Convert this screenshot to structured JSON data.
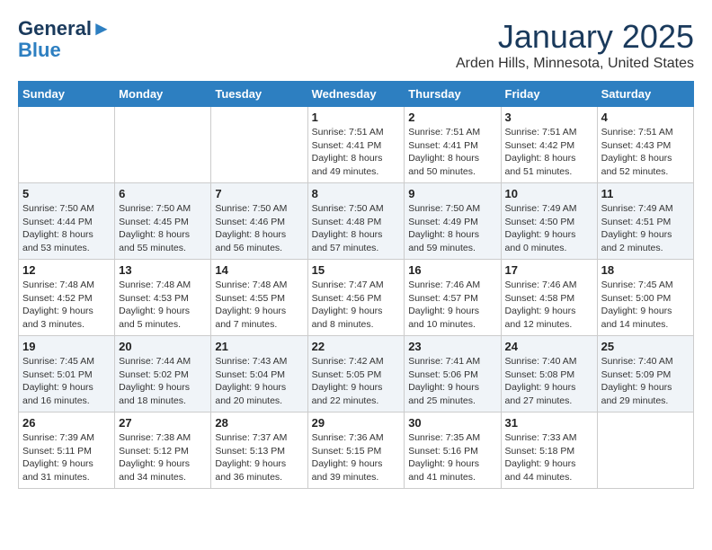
{
  "logo": {
    "line1": "General",
    "line2": "Blue"
  },
  "title": "January 2025",
  "location": "Arden Hills, Minnesota, United States",
  "days_header": [
    "Sunday",
    "Monday",
    "Tuesday",
    "Wednesday",
    "Thursday",
    "Friday",
    "Saturday"
  ],
  "weeks": [
    [
      {
        "day": "",
        "sunrise": "",
        "sunset": "",
        "daylight": ""
      },
      {
        "day": "",
        "sunrise": "",
        "sunset": "",
        "daylight": ""
      },
      {
        "day": "",
        "sunrise": "",
        "sunset": "",
        "daylight": ""
      },
      {
        "day": "1",
        "sunrise": "Sunrise: 7:51 AM",
        "sunset": "Sunset: 4:41 PM",
        "daylight": "Daylight: 8 hours and 49 minutes."
      },
      {
        "day": "2",
        "sunrise": "Sunrise: 7:51 AM",
        "sunset": "Sunset: 4:41 PM",
        "daylight": "Daylight: 8 hours and 50 minutes."
      },
      {
        "day": "3",
        "sunrise": "Sunrise: 7:51 AM",
        "sunset": "Sunset: 4:42 PM",
        "daylight": "Daylight: 8 hours and 51 minutes."
      },
      {
        "day": "4",
        "sunrise": "Sunrise: 7:51 AM",
        "sunset": "Sunset: 4:43 PM",
        "daylight": "Daylight: 8 hours and 52 minutes."
      }
    ],
    [
      {
        "day": "5",
        "sunrise": "Sunrise: 7:50 AM",
        "sunset": "Sunset: 4:44 PM",
        "daylight": "Daylight: 8 hours and 53 minutes."
      },
      {
        "day": "6",
        "sunrise": "Sunrise: 7:50 AM",
        "sunset": "Sunset: 4:45 PM",
        "daylight": "Daylight: 8 hours and 55 minutes."
      },
      {
        "day": "7",
        "sunrise": "Sunrise: 7:50 AM",
        "sunset": "Sunset: 4:46 PM",
        "daylight": "Daylight: 8 hours and 56 minutes."
      },
      {
        "day": "8",
        "sunrise": "Sunrise: 7:50 AM",
        "sunset": "Sunset: 4:48 PM",
        "daylight": "Daylight: 8 hours and 57 minutes."
      },
      {
        "day": "9",
        "sunrise": "Sunrise: 7:50 AM",
        "sunset": "Sunset: 4:49 PM",
        "daylight": "Daylight: 8 hours and 59 minutes."
      },
      {
        "day": "10",
        "sunrise": "Sunrise: 7:49 AM",
        "sunset": "Sunset: 4:50 PM",
        "daylight": "Daylight: 9 hours and 0 minutes."
      },
      {
        "day": "11",
        "sunrise": "Sunrise: 7:49 AM",
        "sunset": "Sunset: 4:51 PM",
        "daylight": "Daylight: 9 hours and 2 minutes."
      }
    ],
    [
      {
        "day": "12",
        "sunrise": "Sunrise: 7:48 AM",
        "sunset": "Sunset: 4:52 PM",
        "daylight": "Daylight: 9 hours and 3 minutes."
      },
      {
        "day": "13",
        "sunrise": "Sunrise: 7:48 AM",
        "sunset": "Sunset: 4:53 PM",
        "daylight": "Daylight: 9 hours and 5 minutes."
      },
      {
        "day": "14",
        "sunrise": "Sunrise: 7:48 AM",
        "sunset": "Sunset: 4:55 PM",
        "daylight": "Daylight: 9 hours and 7 minutes."
      },
      {
        "day": "15",
        "sunrise": "Sunrise: 7:47 AM",
        "sunset": "Sunset: 4:56 PM",
        "daylight": "Daylight: 9 hours and 8 minutes."
      },
      {
        "day": "16",
        "sunrise": "Sunrise: 7:46 AM",
        "sunset": "Sunset: 4:57 PM",
        "daylight": "Daylight: 9 hours and 10 minutes."
      },
      {
        "day": "17",
        "sunrise": "Sunrise: 7:46 AM",
        "sunset": "Sunset: 4:58 PM",
        "daylight": "Daylight: 9 hours and 12 minutes."
      },
      {
        "day": "18",
        "sunrise": "Sunrise: 7:45 AM",
        "sunset": "Sunset: 5:00 PM",
        "daylight": "Daylight: 9 hours and 14 minutes."
      }
    ],
    [
      {
        "day": "19",
        "sunrise": "Sunrise: 7:45 AM",
        "sunset": "Sunset: 5:01 PM",
        "daylight": "Daylight: 9 hours and 16 minutes."
      },
      {
        "day": "20",
        "sunrise": "Sunrise: 7:44 AM",
        "sunset": "Sunset: 5:02 PM",
        "daylight": "Daylight: 9 hours and 18 minutes."
      },
      {
        "day": "21",
        "sunrise": "Sunrise: 7:43 AM",
        "sunset": "Sunset: 5:04 PM",
        "daylight": "Daylight: 9 hours and 20 minutes."
      },
      {
        "day": "22",
        "sunrise": "Sunrise: 7:42 AM",
        "sunset": "Sunset: 5:05 PM",
        "daylight": "Daylight: 9 hours and 22 minutes."
      },
      {
        "day": "23",
        "sunrise": "Sunrise: 7:41 AM",
        "sunset": "Sunset: 5:06 PM",
        "daylight": "Daylight: 9 hours and 25 minutes."
      },
      {
        "day": "24",
        "sunrise": "Sunrise: 7:40 AM",
        "sunset": "Sunset: 5:08 PM",
        "daylight": "Daylight: 9 hours and 27 minutes."
      },
      {
        "day": "25",
        "sunrise": "Sunrise: 7:40 AM",
        "sunset": "Sunset: 5:09 PM",
        "daylight": "Daylight: 9 hours and 29 minutes."
      }
    ],
    [
      {
        "day": "26",
        "sunrise": "Sunrise: 7:39 AM",
        "sunset": "Sunset: 5:11 PM",
        "daylight": "Daylight: 9 hours and 31 minutes."
      },
      {
        "day": "27",
        "sunrise": "Sunrise: 7:38 AM",
        "sunset": "Sunset: 5:12 PM",
        "daylight": "Daylight: 9 hours and 34 minutes."
      },
      {
        "day": "28",
        "sunrise": "Sunrise: 7:37 AM",
        "sunset": "Sunset: 5:13 PM",
        "daylight": "Daylight: 9 hours and 36 minutes."
      },
      {
        "day": "29",
        "sunrise": "Sunrise: 7:36 AM",
        "sunset": "Sunset: 5:15 PM",
        "daylight": "Daylight: 9 hours and 39 minutes."
      },
      {
        "day": "30",
        "sunrise": "Sunrise: 7:35 AM",
        "sunset": "Sunset: 5:16 PM",
        "daylight": "Daylight: 9 hours and 41 minutes."
      },
      {
        "day": "31",
        "sunrise": "Sunrise: 7:33 AM",
        "sunset": "Sunset: 5:18 PM",
        "daylight": "Daylight: 9 hours and 44 minutes."
      },
      {
        "day": "",
        "sunrise": "",
        "sunset": "",
        "daylight": ""
      }
    ]
  ]
}
